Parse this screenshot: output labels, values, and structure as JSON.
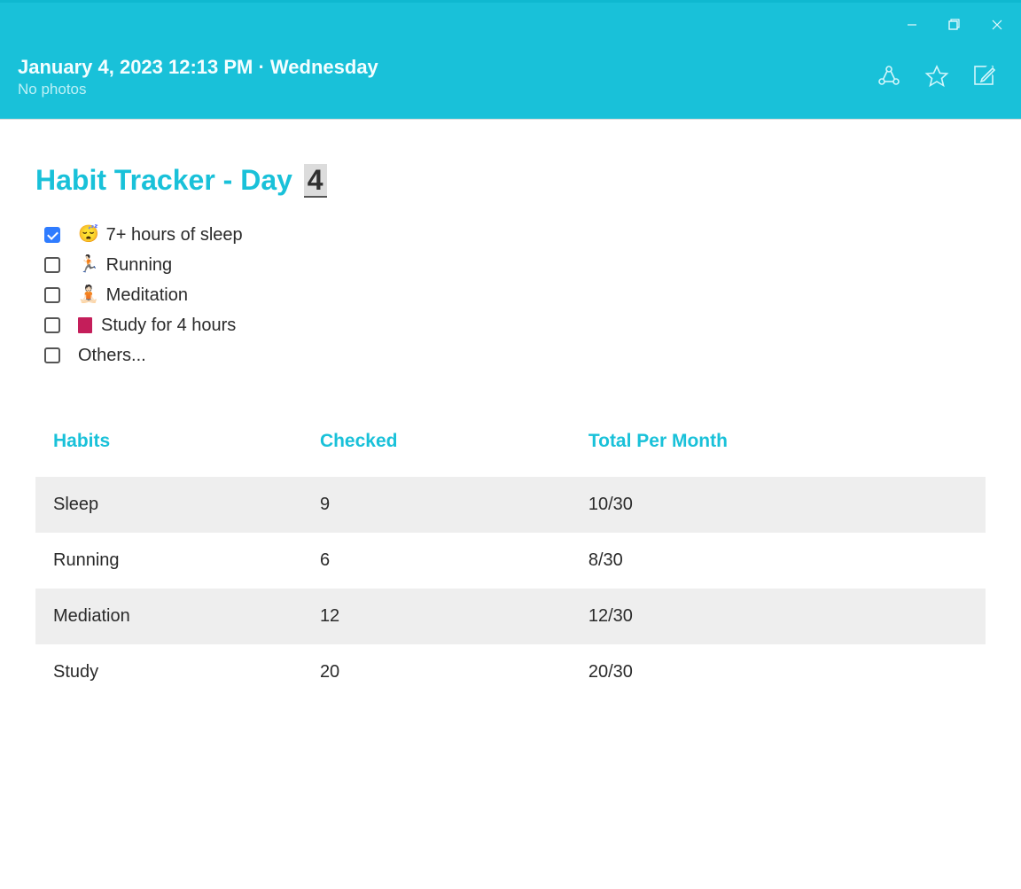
{
  "header": {
    "date_line": "January 4, 2023 12:13 PM · Wednesday",
    "subtitle": "No photos"
  },
  "title": {
    "prefix": "Habit Tracker - Day ",
    "day_number": "4"
  },
  "checklist": [
    {
      "checked": true,
      "emoji": "😴",
      "label": "7+ hours of sleep"
    },
    {
      "checked": false,
      "emoji": "🏃🏻",
      "label": "Running"
    },
    {
      "checked": false,
      "emoji": "🧘🏻",
      "label": "Meditation"
    },
    {
      "checked": false,
      "emoji": "book",
      "label": "Study for 4 hours"
    },
    {
      "checked": false,
      "emoji": "",
      "label": "Others..."
    }
  ],
  "table": {
    "headers": [
      "Habits",
      "Checked",
      "Total Per Month"
    ],
    "rows": [
      {
        "habit": "Sleep",
        "checked": "9",
        "total": "10/30"
      },
      {
        "habit": "Running",
        "checked": "6",
        "total": "8/30"
      },
      {
        "habit": "Mediation",
        "checked": "12",
        "total": "12/30"
      },
      {
        "habit": "Study",
        "checked": "20",
        "total": "20/30"
      }
    ]
  }
}
